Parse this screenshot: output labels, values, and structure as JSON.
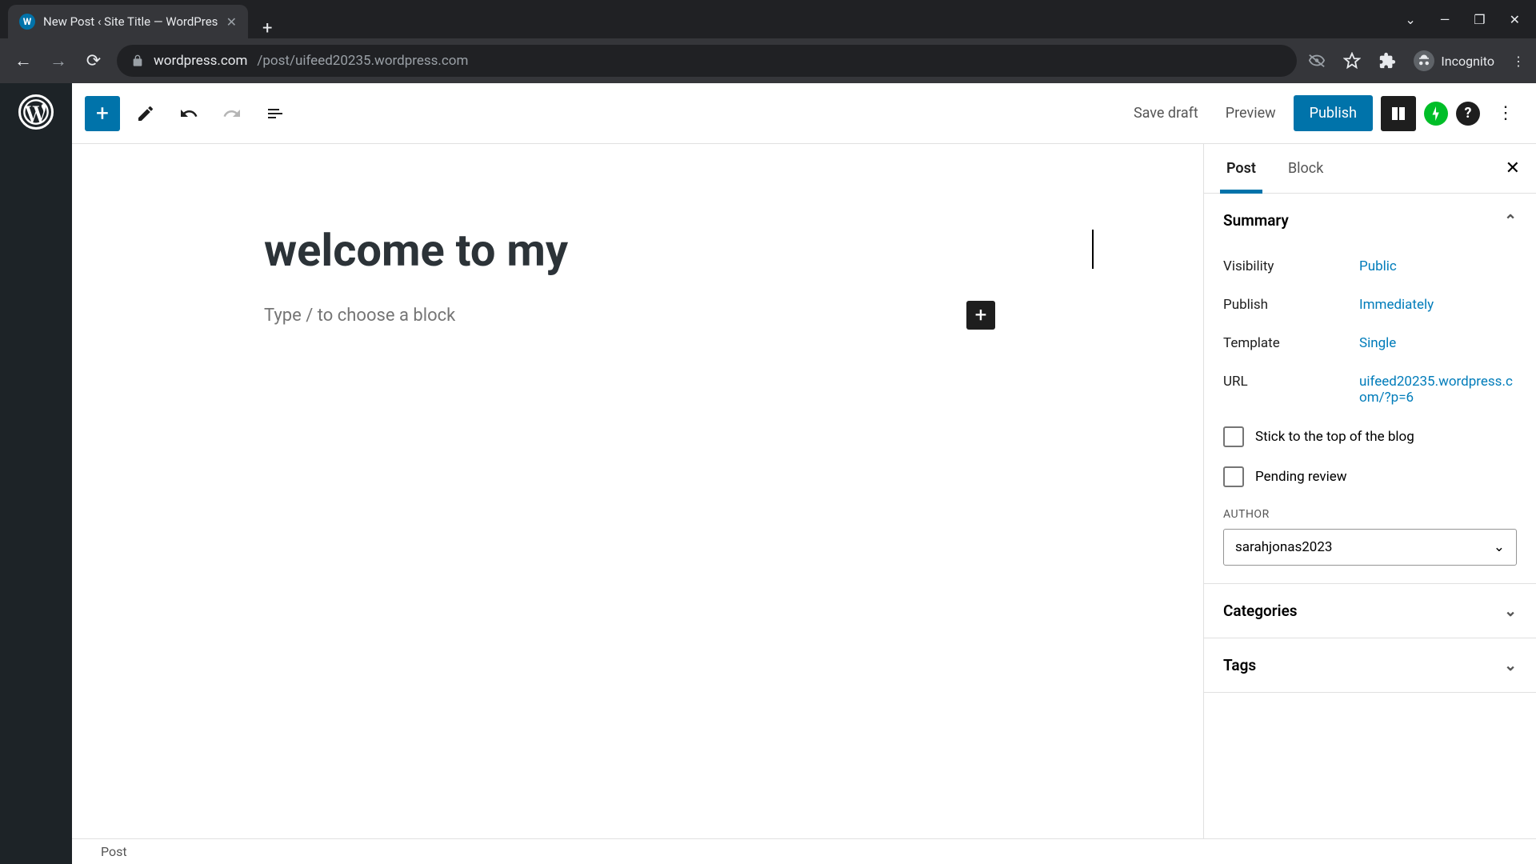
{
  "browser": {
    "tab_title": "New Post ‹ Site Title — WordPres",
    "url_host": "wordpress.com",
    "url_path": "/post/uifeed20235.wordpress.com",
    "incognito_label": "Incognito"
  },
  "toolbar": {
    "save_draft": "Save draft",
    "preview": "Preview",
    "publish": "Publish"
  },
  "editor": {
    "title": "welcome to my",
    "block_placeholder": "Type / to choose a block"
  },
  "sidebar": {
    "tabs": {
      "post": "Post",
      "block": "Block"
    },
    "summary": {
      "heading": "Summary",
      "visibility_label": "Visibility",
      "visibility_value": "Public",
      "publish_label": "Publish",
      "publish_value": "Immediately",
      "template_label": "Template",
      "template_value": "Single",
      "url_label": "URL",
      "url_value": "uifeed20235.wordpress.com/?p=6",
      "stick_label": "Stick to the top of the blog",
      "pending_label": "Pending review",
      "author_heading": "AUTHOR",
      "author_value": "sarahjonas2023"
    },
    "categories": "Categories",
    "tags": "Tags"
  },
  "statusbar": {
    "mode": "Post"
  }
}
